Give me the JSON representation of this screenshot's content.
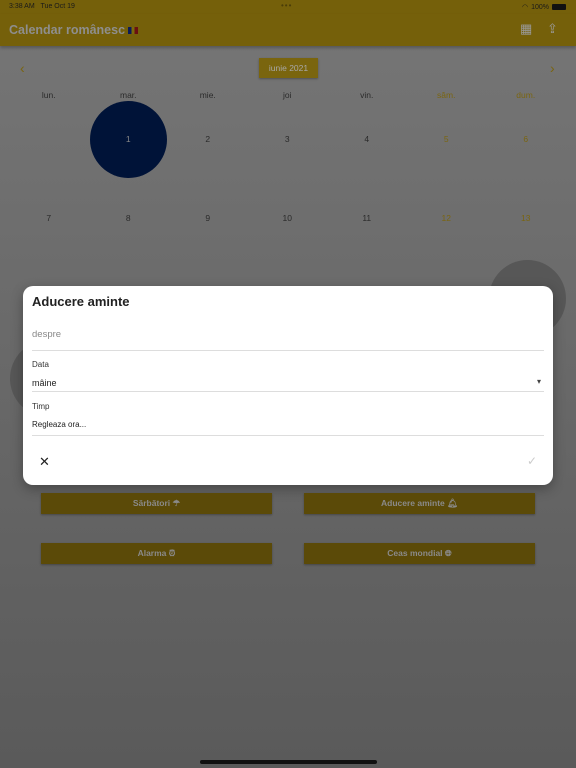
{
  "status_bar": {
    "time": "3:38 AM",
    "date": "Tue Oct 19",
    "dots": "•••",
    "battery": "100%"
  },
  "app_bar": {
    "title": "Calendar românesc",
    "icons": [
      "grid-icon",
      "share-icon"
    ]
  },
  "calendar": {
    "month_label": "iunie 2021",
    "weekdays": [
      "lun.",
      "mar.",
      "mie.",
      "joi",
      "vin.",
      "sâm.",
      "dum."
    ],
    "weeks": [
      [
        "",
        "1",
        "2",
        "3",
        "4",
        "5",
        "6"
      ],
      [
        "7",
        "8",
        "9",
        "10",
        "11",
        "12",
        "13"
      ]
    ],
    "selected_day": "1",
    "colors": {
      "selected": "#001338",
      "weekend": "#7a6510"
    }
  },
  "dialog": {
    "title": "Aducere aminte",
    "about_placeholder": "despre",
    "date_label": "Data",
    "date_value": "mâine",
    "time_label": "Timp",
    "time_value": "Regleaza ora..."
  },
  "buttons": [
    {
      "label": "Sărbători",
      "icon": "umbrella-icon"
    },
    {
      "label": "Aducere aminte",
      "icon": "alarm-bell-icon"
    },
    {
      "label": "Alarma",
      "icon": "alarm-clock-icon"
    },
    {
      "label": "Ceas mondial",
      "icon": "globe-icon"
    }
  ]
}
